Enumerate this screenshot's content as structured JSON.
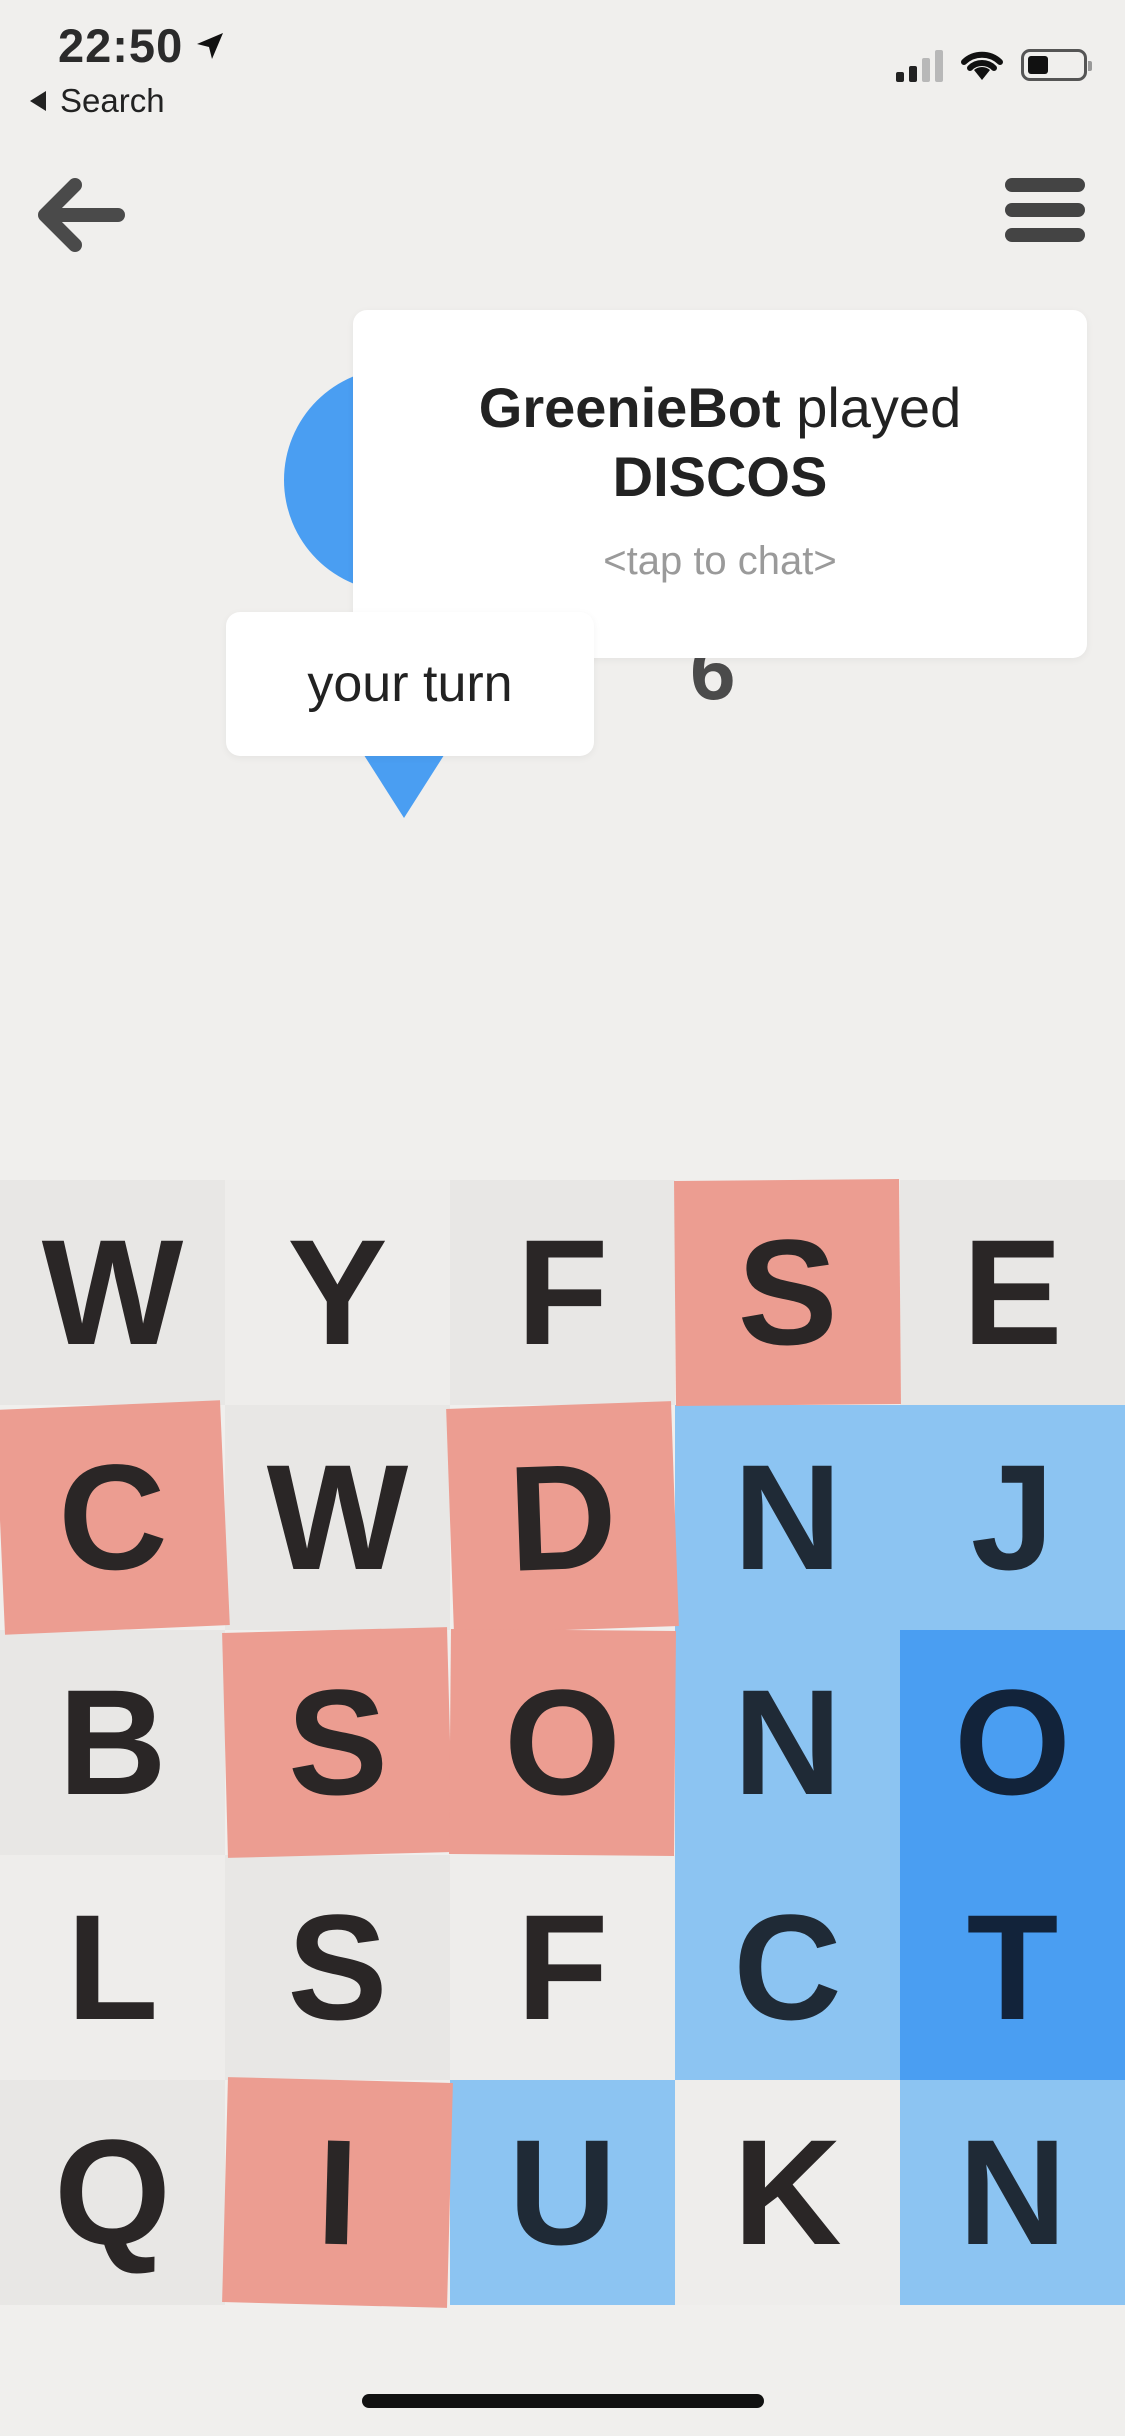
{
  "status_bar": {
    "time": "22:50",
    "back_app_label": "Search"
  },
  "game": {
    "notification": {
      "player": "GreenieBot",
      "verb": "played",
      "word": "DISCOS",
      "hint": "<tap to chat>"
    },
    "turn_label": "your turn",
    "opponent_score": "6"
  },
  "colors": {
    "background": "#f0efed",
    "tile_neutral_a": "#e8e7e5",
    "tile_neutral_b": "#eeedeb",
    "tile_red": "#ec9d91",
    "tile_blue_light": "#8cc4f2",
    "tile_blue_dark": "#4a9ef2"
  },
  "board": {
    "rows": [
      [
        {
          "letter": "W",
          "state": "neutral"
        },
        {
          "letter": "Y",
          "state": "neutral"
        },
        {
          "letter": "F",
          "state": "neutral"
        },
        {
          "letter": "S",
          "state": "red"
        },
        {
          "letter": "E",
          "state": "neutral"
        }
      ],
      [
        {
          "letter": "C",
          "state": "red"
        },
        {
          "letter": "W",
          "state": "neutral"
        },
        {
          "letter": "D",
          "state": "red"
        },
        {
          "letter": "N",
          "state": "blue-light"
        },
        {
          "letter": "J",
          "state": "blue-light"
        }
      ],
      [
        {
          "letter": "B",
          "state": "neutral"
        },
        {
          "letter": "S",
          "state": "red"
        },
        {
          "letter": "O",
          "state": "red"
        },
        {
          "letter": "N",
          "state": "blue-light"
        },
        {
          "letter": "O",
          "state": "blue-dark"
        }
      ],
      [
        {
          "letter": "L",
          "state": "neutral"
        },
        {
          "letter": "S",
          "state": "neutral"
        },
        {
          "letter": "F",
          "state": "neutral"
        },
        {
          "letter": "C",
          "state": "blue-light"
        },
        {
          "letter": "T",
          "state": "blue-dark"
        }
      ],
      [
        {
          "letter": "Q",
          "state": "neutral"
        },
        {
          "letter": "I",
          "state": "red"
        },
        {
          "letter": "U",
          "state": "blue-light"
        },
        {
          "letter": "K",
          "state": "neutral"
        },
        {
          "letter": "N",
          "state": "blue-light"
        }
      ]
    ]
  }
}
